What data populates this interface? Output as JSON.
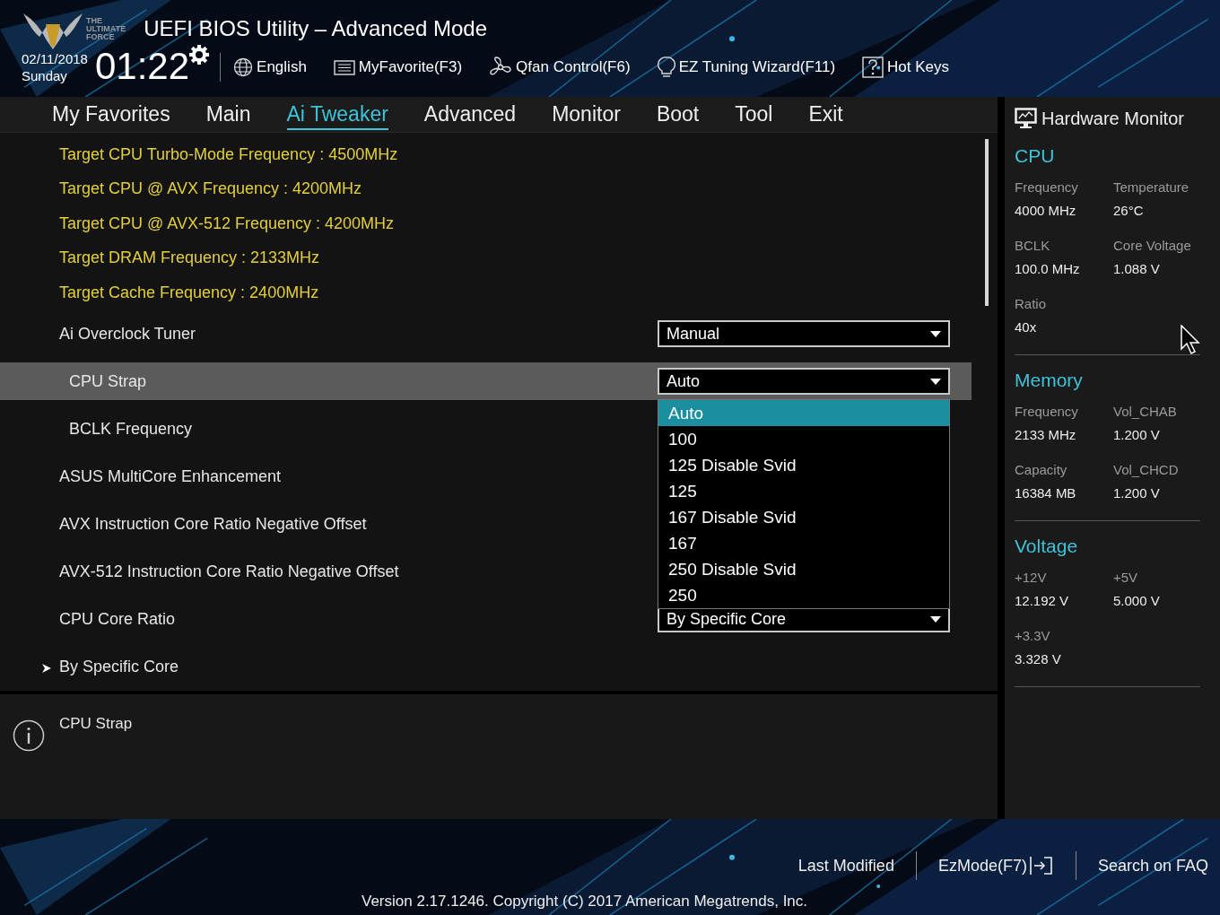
{
  "header": {
    "logo_text": [
      "THE",
      "ULTIMATE",
      "FORCE"
    ],
    "title": "UEFI BIOS Utility – Advanced Mode",
    "date": "02/11/2018",
    "day": "Sunday",
    "time": "01:22",
    "toolbar": [
      {
        "kind": "language",
        "label": "English"
      },
      {
        "kind": "favorite",
        "label": "MyFavorite(F3)"
      },
      {
        "kind": "fan",
        "label": "Qfan Control(F6)"
      },
      {
        "kind": "wizard",
        "label": "EZ Tuning Wizard(F11)"
      },
      {
        "kind": "help",
        "label": "Hot Keys"
      }
    ]
  },
  "tabs": [
    {
      "label": "My Favorites",
      "selected": false
    },
    {
      "label": "Main",
      "selected": false
    },
    {
      "label": "Ai Tweaker",
      "selected": true
    },
    {
      "label": "Advanced",
      "selected": false
    },
    {
      "label": "Monitor",
      "selected": false
    },
    {
      "label": "Boot",
      "selected": false
    },
    {
      "label": "Tool",
      "selected": false
    },
    {
      "label": "Exit",
      "selected": false
    }
  ],
  "settings": [
    {
      "kind": "info",
      "label": "Target CPU Turbo-Mode Frequency : 4500MHz"
    },
    {
      "kind": "info",
      "label": "Target CPU @ AVX Frequency : 4200MHz"
    },
    {
      "kind": "info",
      "label": "Target CPU @ AVX-512 Frequency : 4200MHz"
    },
    {
      "kind": "info",
      "label": "Target DRAM Frequency : 2133MHz"
    },
    {
      "kind": "info",
      "label": "Target Cache Frequency : 2400MHz"
    },
    {
      "kind": "dropdown",
      "label": "Ai Overclock Tuner",
      "value": "Manual",
      "selected": false,
      "indented": false
    },
    {
      "kind": "dropdown",
      "label": "CPU Strap",
      "value": "Auto",
      "selected": true,
      "indented": true,
      "options": [
        {
          "label": "Auto",
          "selected": true
        },
        {
          "label": "100",
          "selected": false
        },
        {
          "label": "125 Disable Svid",
          "selected": false
        },
        {
          "label": "125",
          "selected": false
        },
        {
          "label": "167 Disable Svid",
          "selected": false
        },
        {
          "label": "167",
          "selected": false
        },
        {
          "label": "250 Disable Svid",
          "selected": false
        },
        {
          "label": "250",
          "selected": false
        }
      ]
    },
    {
      "kind": "plain",
      "label": "BCLK Frequency",
      "selected": false,
      "indented": true
    },
    {
      "kind": "plain",
      "label": "ASUS MultiCore Enhancement",
      "selected": false,
      "indented": false
    },
    {
      "kind": "plain",
      "label": "AVX Instruction Core Ratio Negative Offset",
      "selected": false,
      "indented": false
    },
    {
      "kind": "plain",
      "label": "AVX-512 Instruction Core Ratio Negative Offset",
      "selected": false,
      "indented": false
    },
    {
      "kind": "dropdown",
      "label": "CPU Core Ratio",
      "value": "By Specific Core",
      "selected": false,
      "indented": false
    },
    {
      "kind": "submenu",
      "label": "By Specific Core",
      "selected": false,
      "indented": false
    }
  ],
  "help": {
    "text": "CPU Strap"
  },
  "hardware_monitor": {
    "title": "Hardware Monitor",
    "sections": [
      {
        "title": "CPU",
        "items": [
          {
            "label": "Frequency",
            "value": "4000 MHz"
          },
          {
            "label": "Temperature",
            "value": "26°C"
          },
          {
            "label": "BCLK",
            "value": "100.0 MHz"
          },
          {
            "label": "Core Voltage",
            "value": "1.088 V"
          },
          {
            "label": "Ratio",
            "value": "40x"
          }
        ]
      },
      {
        "title": "Memory",
        "items": [
          {
            "label": "Frequency",
            "value": "2133 MHz"
          },
          {
            "label": "Vol_CHAB",
            "value": "1.200 V"
          },
          {
            "label": "Capacity",
            "value": "16384 MB"
          },
          {
            "label": "Vol_CHCD",
            "value": "1.200 V"
          }
        ]
      },
      {
        "title": "Voltage",
        "items": [
          {
            "label": "+12V",
            "value": "12.192 V"
          },
          {
            "label": "+5V",
            "value": "5.000 V"
          },
          {
            "label": "+3.3V",
            "value": "3.328 V"
          }
        ]
      }
    ]
  },
  "footer": {
    "actions": [
      {
        "kind": "plain",
        "label": "Last Modified"
      },
      {
        "kind": "ezmode",
        "label": "EzMode(F7)"
      },
      {
        "kind": "plain",
        "label": "Search on FAQ"
      }
    ],
    "version": "Version 2.17.1246. Copyright (C) 2017 American Megatrends, Inc."
  }
}
